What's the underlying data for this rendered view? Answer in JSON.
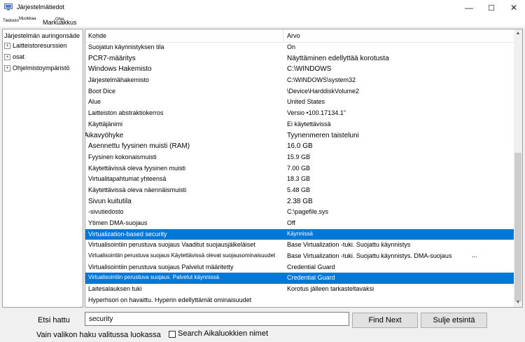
{
  "window": {
    "title": "Järjestelmätiedot",
    "controls": {
      "minimize": "—",
      "maximize": "☐",
      "close": "✕"
    }
  },
  "menubar": {
    "items": [
      "Tiedosto",
      "Muokkaa",
      "Markuakkus",
      "Ohje"
    ]
  },
  "tree": {
    "root": "Järjestelmän auringonsäde",
    "children": [
      "Laitteistoresurssien",
      "osat",
      "Ohjelmistoympäristö"
    ],
    "expander": "+"
  },
  "list": {
    "headers": {
      "item": "Kohde",
      "value": "Arvo"
    },
    "rows": [
      {
        "item": "Suojatun käynnistyksen tila",
        "value": "On"
      },
      {
        "item": "PCR7-määritys",
        "value": "Näyttäminen edellyttää korotusta"
      },
      {
        "item": "Windows  Hakemisto",
        "value": "C:\\WINDOWS"
      },
      {
        "item": "Järjestelmähakemisto",
        "value": "C:\\WINDOWS\\system32"
      },
      {
        "item": "Boot Dice",
        "value": "\\Device\\HarddiskVolume2"
      },
      {
        "item": "Alue",
        "value": "United States"
      },
      {
        "item": "Laitteiston abstraktiokerros",
        "value": "Versio •100.17134.1\""
      },
      {
        "item": "Käyttäjänimi",
        "value": "Ei käytettävissä"
      },
      {
        "item": "Aikavyöhyke",
        "value": "Tyynenmeren taisteluni"
      },
      {
        "item": "Asennettu fyysinen muisti (RAM)",
        "value": "16.0 GB"
      },
      {
        "item": "Fyysinen kokonaismuisti",
        "value": "15.9 GB"
      },
      {
        "item": "Käytettävissä oleva fyysinen muisti",
        "value": "7.00 GB"
      },
      {
        "item": "Virtualitapahtumat yhteensä",
        "value": "18.3 GB"
      },
      {
        "item": "Käytettävissä oleva näennäismuisti",
        "value": "5.48 GB"
      },
      {
        "item": "Sivun kuitutila",
        "value": "2.38 GB"
      },
      {
        "item": "-sivutiedosto",
        "value": "C:\\pagefile.sys"
      },
      {
        "item": "Ytimen DMA-suojaus",
        "value": "Off"
      },
      {
        "item": "Virtualization-based security",
        "value": "Käynnissä"
      },
      {
        "item": "Virtualisointiin perustuva suojaus Vaaditut suojausjälkeläiset",
        "value": "Base Virtualization -tuki. Suojattu käynnistys"
      },
      {
        "item": "Virtualisointiin perustuva suojaus Käytettävissä olevat suojausominaisuudet",
        "value": "Base Virtualization -tuki. Suojattu käynnistys. DMA-suojaus",
        "extra": "..."
      },
      {
        "item": "Virtualisointiin perustuva suojaus Palvelut määritetty",
        "value": "Credential Guard"
      },
      {
        "item": "Virtualisointiin perustuva suojaus. Palvelut käynnissä",
        "value": "Credential Guard"
      },
      {
        "item": "Laitesalauksen tuki",
        "value": "Korotus jälleen tarkasteltavaksi"
      },
      {
        "item": "Hyperhsori on havaittu. Hyperin edellyttämät ominaisuudet",
        "value": ""
      }
    ],
    "selected_color": "#0078d7"
  },
  "search": {
    "label": "Etsi hattu",
    "value": "security",
    "find_button": "Find Next",
    "close_button": "Sulje etsintä",
    "only_selected_label": "Vain valikon haku valitussa luokassa",
    "category_names_checkbox_label": "Search Aikaluokkien nimet"
  },
  "scrollbar": {
    "up": "▲",
    "down": "▼"
  }
}
